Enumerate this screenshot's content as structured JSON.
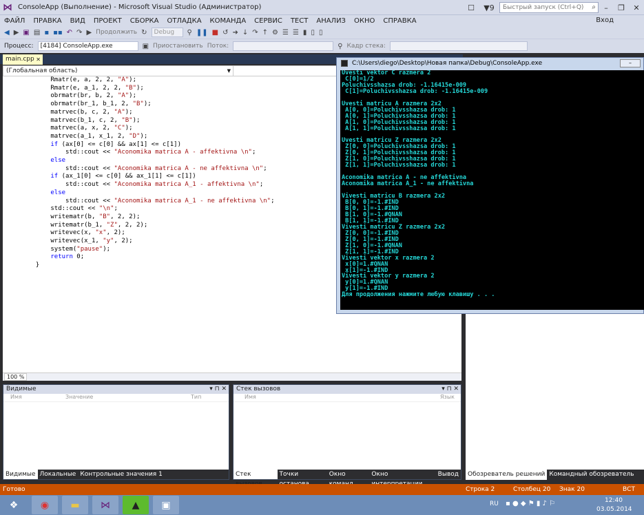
{
  "window": {
    "title": "ConsoleApp (Выполнение) - Microsoft Visual Studio (Администратор)",
    "notifications": "▼9",
    "quick_launch_placeholder": "Быстрый запуск (Ctrl+Q)",
    "login": "Вход"
  },
  "menu": [
    "ФАЙЛ",
    "ПРАВКА",
    "ВИД",
    "ПРОЕКТ",
    "СБОРКА",
    "ОТЛАДКА",
    "КОМАНДА",
    "СЕРВИС",
    "ТЕСТ",
    "АНАЛИЗ",
    "ОКНО",
    "СПРАВКА"
  ],
  "toolbar": {
    "continue_label": "Продолжить",
    "config": "Debug",
    "process_label": "Процесс:",
    "process_value": "[4184] ConsoleApp.exe",
    "suspend_label": "Приостановить",
    "thread_label": "Поток:",
    "stack_frame_label": "Кадр стека:"
  },
  "editor": {
    "tab_label": "main.cpp",
    "scope": "(Глобальная область)",
    "zoom": "100 %",
    "lines": [
      {
        "indent": "        ",
        "text": "Rmatr(e, a, 2, 2, \"A\");"
      },
      {
        "indent": "        ",
        "text": "Rmatr(e, a_1, 2, 2, \"B\");"
      },
      {
        "indent": "",
        "text": ""
      },
      {
        "indent": "        ",
        "text": "obrmatr(br, b, 2, \"A\");"
      },
      {
        "indent": "        ",
        "text": "obrmatr(br_1, b_1, 2, \"B\");"
      },
      {
        "indent": "",
        "text": ""
      },
      {
        "indent": "        ",
        "text": "matrvec(b, c, 2, \"A\");"
      },
      {
        "indent": "        ",
        "text": "matrvec(b_1, c, 2, \"B\");"
      },
      {
        "indent": "        ",
        "text": "matrvec(a, x, 2, \"C\");"
      },
      {
        "indent": "        ",
        "text": "matrvec(a_1, x_1, 2, \"D\");"
      },
      {
        "indent": "",
        "text": ""
      },
      {
        "indent": "        ",
        "text": "if (ax[0] <= c[0] && ax[1] <= c[1])"
      },
      {
        "indent": "            ",
        "text": "std::cout << \"Aconomika matrica A - affektivna \\n\";"
      },
      {
        "indent": "        ",
        "text": "else"
      },
      {
        "indent": "            ",
        "text": "std::cout << \"Aconomika matrica A - ne affektivna \\n\";"
      },
      {
        "indent": "        ",
        "text": "if (ax_1[0] <= c[0] && ax_1[1] <= c[1])"
      },
      {
        "indent": "            ",
        "text": "std::cout << \"Aconomika matrica A_1 - affektivna \\n\";"
      },
      {
        "indent": "        ",
        "text": "else"
      },
      {
        "indent": "            ",
        "text": "std::cout << \"Aconomika matrica A_1 - ne affektivna \\n\";"
      },
      {
        "indent": "        ",
        "text": "std::cout << \"\\n\";"
      },
      {
        "indent": "",
        "text": ""
      },
      {
        "indent": "        ",
        "text": "writematr(b, \"B\", 2, 2);"
      },
      {
        "indent": "        ",
        "text": "writematr(b_1, \"Z\", 2, 2);"
      },
      {
        "indent": "        ",
        "text": "writevec(x, \"x\", 2);"
      },
      {
        "indent": "        ",
        "text": "writevec(x_1, \"y\", 2);"
      },
      {
        "indent": "",
        "text": ""
      },
      {
        "indent": "        ",
        "text": "system(\"pause\");"
      },
      {
        "indent": "        ",
        "text": "return 0;"
      },
      {
        "indent": "    ",
        "text": "}"
      }
    ]
  },
  "locals_panel": {
    "title": "Видимые",
    "cols": [
      "Имя",
      "Значение",
      "Тип"
    ],
    "tabs": [
      "Видимые",
      "Локальные",
      "Контрольные значения 1"
    ]
  },
  "callstack_panel": {
    "title": "Стек вызовов",
    "cols": [
      "Имя",
      "Язык"
    ],
    "tabs": [
      "Стек вызовов",
      "Точки останова",
      "Окно команд",
      "Окно интерпретации",
      "Вывод"
    ]
  },
  "right_tabs": [
    "Обозреватель решений",
    "Командный обозреватель"
  ],
  "console": {
    "title": "C:\\Users\\diego\\Desktop\\Новая папка\\Debug\\ConsoleApp.exe",
    "lines": [
      "Uvesti vektor C razmera 2",
      " C[0]=1/2",
      "Poluchivsshazsa drob: -1.16415e-009",
      " C[1]=Poluchivsshazsa drob: -1.16415e-009",
      "",
      "Uvesti matricu A razmera 2x2",
      " A[0, 0]=Poluchivsshazsa drob: 1",
      " A[0, 1]=Poluchivsshazsa drob: 1",
      " A[1, 0]=Poluchivsshazsa drob: 1",
      " A[1, 1]=Poluchivsshazsa drob: 1",
      "",
      "Uvesti matricu Z razmera 2x2",
      " Z[0, 0]=Poluchivsshazsa drob: 1",
      " Z[0, 1]=Poluchivsshazsa drob: 1",
      " Z[1, 0]=Poluchivsshazsa drob: 1",
      " Z[1, 1]=Poluchivsshazsa drob: 1",
      "",
      "Aconomika matrica A - ne affektivna",
      "Aconomika matrica A_1 - ne affektivna",
      "",
      "Vivesti matricu B razmera 2x2",
      " B[0, 0]=-1.#IND",
      " B[0, 1]=-1.#IND",
      " B[1, 0]=-1.#QNAN",
      " B[1, 1]=-1.#IND",
      "Vivesti matricu Z razmera 2x2",
      " Z[0, 0]=-1.#IND",
      " Z[0, 1]=-1.#IND",
      " Z[1, 0]=-1.#QNAN",
      " Z[1, 1]=-1.#IND",
      "Vivesti vektor x razmera 2",
      " x[0]=1.#QNAN",
      " x[1]=-1.#IND",
      "Vivesti vektor y razmera 2",
      " y[0]=1.#QNAN",
      " y[1]=-1.#IND",
      "Для продолжения нажмите любую клавишу . . ."
    ]
  },
  "status": {
    "ready": "Готово",
    "line": "Строка 2",
    "col": "Столбец 20",
    "char": "Знак 20",
    "mode": "ВСТ"
  },
  "taskbar": {
    "lang": "RU",
    "time": "12:40",
    "date": "03.05.2014"
  }
}
